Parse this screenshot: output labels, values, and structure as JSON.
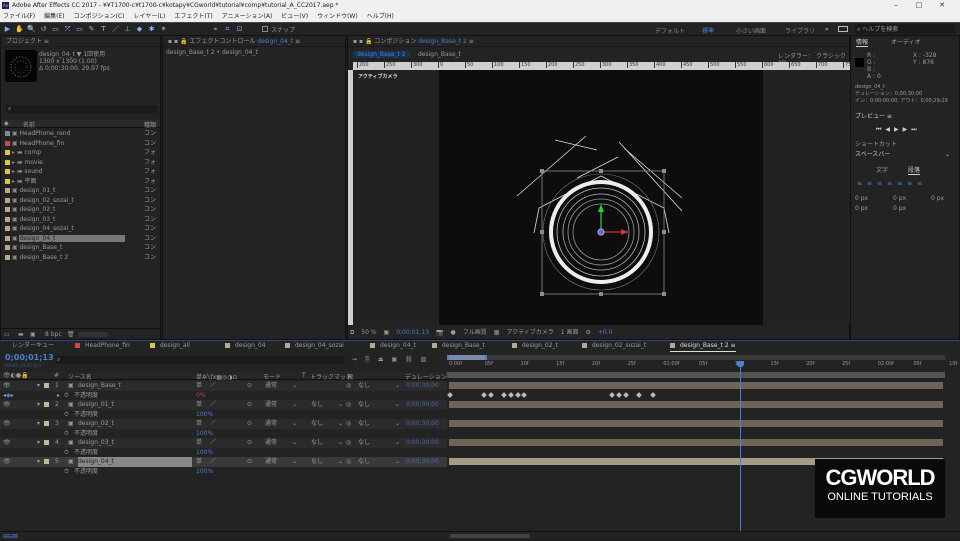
{
  "window": {
    "title": "Adobe After Effects CC 2017 - ¥¥T1700-c¥t1700-c¥kotapy¥CGworld¥tutorial¥comp¥tutorial_A_CC2017.aep *",
    "app_icon": "Ae"
  },
  "menu": [
    "ファイル(F)",
    "編集(E)",
    "コンポジション(C)",
    "レイヤー(L)",
    "エフェクト(T)",
    "アニメーション(A)",
    "ビュー(V)",
    "ウィンドウ(W)",
    "ヘルプ(H)"
  ],
  "toolbar": {
    "snap_label": "スナップ"
  },
  "workspaces": {
    "items": [
      "デフォルト",
      "標準",
      "小さい画面",
      "ライブラリ"
    ],
    "active": "標準",
    "more": "»",
    "search_placeholder": "ヘルプを検索"
  },
  "project": {
    "title": "プロジェクト",
    "selected_name": "design_04_t ▼ 1回使用",
    "selected_size": "1300 x 1300 (1.00)",
    "selected_duration": "Δ 0;00;30;00, 29.97 fps",
    "col_name": "名前",
    "col_type": "種類",
    "bpc": "8 bpc",
    "items": [
      {
        "name": "HeadPhone_rend",
        "type": "コン",
        "color": "#8a8a8a",
        "folder": false
      },
      {
        "name": "HeadPhone_fin",
        "type": "コン",
        "color": "#c84a4a",
        "folder": false
      },
      {
        "name": "comp",
        "type": "フォ",
        "color": "#d8c84a",
        "folder": true
      },
      {
        "name": "movie",
        "type": "フォ",
        "color": "#d8c84a",
        "folder": true
      },
      {
        "name": "sound",
        "type": "フォ",
        "color": "#d8c84a",
        "folder": true
      },
      {
        "name": "平面",
        "type": "フォ",
        "color": "#d8c84a",
        "folder": true
      },
      {
        "name": "design_01_t",
        "type": "コン",
        "color": "#b8a890",
        "folder": false
      },
      {
        "name": "design_02_sozai_t",
        "type": "コン",
        "color": "#b8a890",
        "folder": false
      },
      {
        "name": "design_02_t",
        "type": "コン",
        "color": "#b8a890",
        "folder": false
      },
      {
        "name": "design_03_t",
        "type": "コン",
        "color": "#b8a890",
        "folder": false
      },
      {
        "name": "design_04_sozai_t",
        "type": "コン",
        "color": "#b8a890",
        "folder": false
      },
      {
        "name": "design_04_t",
        "type": "コン",
        "color": "#b8a890",
        "folder": false,
        "selected": true
      },
      {
        "name": "design_Base_t",
        "type": "コン",
        "color": "#b8a890",
        "folder": false
      },
      {
        "name": "design_Base_t 2",
        "type": "コン",
        "color": "#b8a890",
        "folder": false
      }
    ]
  },
  "effect_controls": {
    "title": "エフェクトコントロール",
    "target": "design_04_t",
    "breadcrumb": "design_Base_t 2 • design_04_t"
  },
  "composition": {
    "title": "コンポジション",
    "target": "design_Base_t 2",
    "tabs": [
      "design_Base_t 2",
      "design_Base_t"
    ],
    "renderer_label": "レンダラー：",
    "renderer": "クラシック3D",
    "camera_label": "アクティブカメラ",
    "ruler": [
      "200",
      "250",
      "300",
      "0",
      "50",
      "100",
      "150",
      "200",
      "250",
      "300",
      "350",
      "400",
      "450",
      "500",
      "550",
      "600",
      "650",
      "700",
      "750"
    ],
    "footer": {
      "zoom": "50 %",
      "timecode": "0;00;01;13",
      "resolution": "フル画質",
      "view": "アクティブカメラ",
      "layout": "1 画面",
      "exposure": "+0.0"
    }
  },
  "info": {
    "tab": "情報",
    "tab2": "オーディオ",
    "r": "R :",
    "g": "G :",
    "b": "B :",
    "a": "A : 0",
    "x": "X : -328",
    "y": "Y : 876",
    "layer": "design_04_t",
    "duration": "デュレーション：0;00;30;00",
    "inout": "イン：0;00;00;00, アウト：0;00;29;29",
    "preview_title": "プレビュー",
    "shortcut_label": "ショートカット",
    "shortcut": "スペースバー",
    "char_tab": "文字",
    "para_tab": "段落",
    "px_values": [
      "0 px",
      "0 px",
      "0 px",
      "0 px",
      "0 px"
    ]
  },
  "timeline": {
    "tabs": [
      {
        "name": "レンダーキュー",
        "color": null
      },
      {
        "name": "HeadPhone_fin",
        "color": "#c84a4a"
      },
      {
        "name": "design_all",
        "color": "#d8c84a"
      },
      {
        "name": "design_04",
        "color": "#b8a890"
      },
      {
        "name": "design_04_sozai",
        "color": "#b8a890"
      },
      {
        "name": "design_04_t",
        "color": "#b8a890"
      },
      {
        "name": "design_Base_t",
        "color": "#b8a890"
      },
      {
        "name": "design_02_t",
        "color": "#b8a890"
      },
      {
        "name": "design_02_sozai_t",
        "color": "#b8a890"
      },
      {
        "name": "design_Base_t 2",
        "color": "#b8a890",
        "active": true
      }
    ],
    "timecode": "0;00;01;13",
    "fps": "00043 (29.97 fps)",
    "headers": {
      "num": "#",
      "source": "ソース名",
      "mode": "モード",
      "t": "T",
      "trkmat": "トラックマット",
      "parent": "親",
      "duration": "デュレーション"
    },
    "ruler": [
      "0:00f",
      "05f",
      "10f",
      "15f",
      "20f",
      "25f",
      "01:00f",
      "05f",
      "10f",
      "15f",
      "20f",
      "25f",
      "02:00f",
      "05f",
      "10f"
    ],
    "playhead_frame": 43,
    "layers": [
      {
        "num": "1",
        "name": "design_Base_t",
        "mode": "通常",
        "trkmat": "",
        "parent": "なし",
        "duration": "0;00;30;00",
        "prop": "不透明度",
        "prop_value": "0%",
        "keyframes": [
          0,
          5,
          6,
          8,
          9,
          10,
          11,
          24,
          25,
          26,
          28,
          30
        ]
      },
      {
        "num": "2",
        "name": "design_01_t",
        "mode": "通常",
        "trkmat": "なし",
        "parent": "なし",
        "duration": "0;00;30;00",
        "prop": "不透明度",
        "prop_value": "100%"
      },
      {
        "num": "3",
        "name": "design_02_t",
        "mode": "通常",
        "trkmat": "なし",
        "parent": "なし",
        "duration": "0;00;30;00",
        "prop": "不透明度",
        "prop_value": "100%"
      },
      {
        "num": "4",
        "name": "design_03_t",
        "mode": "通常",
        "trkmat": "なし",
        "parent": "なし",
        "duration": "0;00;30;00",
        "prop": "不透明度",
        "prop_value": "100%"
      },
      {
        "num": "5",
        "name": "design_04_t",
        "mode": "通常",
        "trkmat": "なし",
        "parent": "なし",
        "duration": "0;00;30;00",
        "prop": "不透明度",
        "prop_value": "100%",
        "selected": true
      }
    ]
  },
  "watermark": {
    "line1": "CGWORLD",
    "line2": "ONLINE TUTORIALS"
  }
}
